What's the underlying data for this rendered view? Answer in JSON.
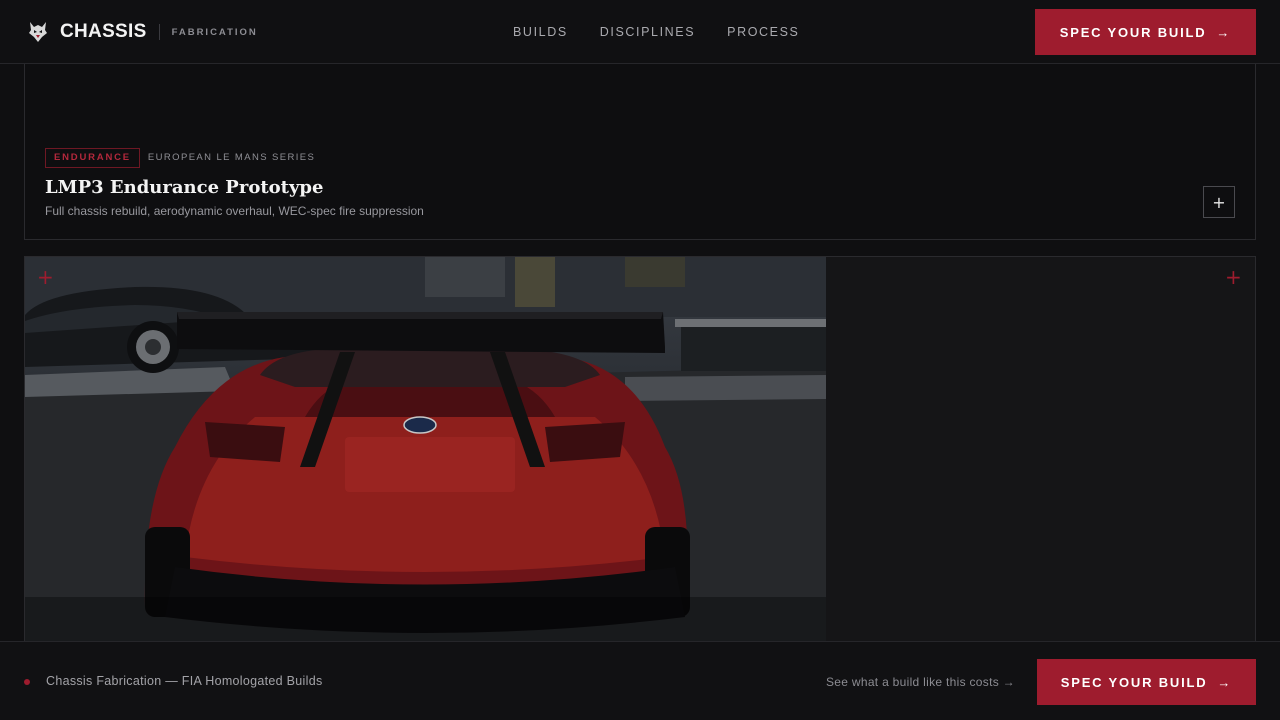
{
  "header": {
    "brand_name": "CHASSIS",
    "brand_sub": "FABRICATION",
    "nav": [
      "BUILDS",
      "DISCIPLINES",
      "PROCESS"
    ],
    "cta_label": "SPEC YOUR BUILD",
    "cta_arrow": "→"
  },
  "card": {
    "tag": "ENDURANCE",
    "series": "EUROPEAN LE MANS SERIES",
    "title": "LMP3 Endurance Prototype",
    "description": "Full chassis rebuild, aerodynamic overhaul, WEC-spec fire suppression",
    "expand_icon": "+"
  },
  "media": {
    "corner_icon": "+"
  },
  "footer": {
    "label": "Chassis Fabrication — FIA Homologated Builds",
    "link": "See what a build like this costs →",
    "cta_label": "SPEC YOUR BUILD",
    "cta_arrow": "→"
  },
  "colors": {
    "accent": "#9e1c2e",
    "background": "#0f0f11",
    "text": "#e6e6e6"
  },
  "icons": {
    "logo": "wolf-head-icon",
    "arrow": "arrow-right-icon",
    "plus": "plus-icon"
  }
}
